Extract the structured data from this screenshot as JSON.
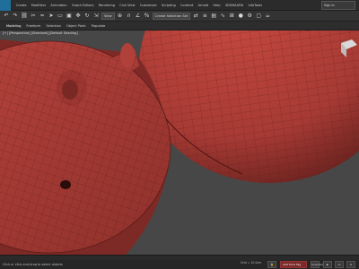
{
  "menubar": {
    "items": [
      "Create",
      "Modifiers",
      "Animation",
      "Graph Editors",
      "Rendering",
      "Civil View",
      "Customize",
      "Scripting",
      "Content",
      "Arnold",
      "Help",
      "3DSMAXFAI",
      "InfoTools"
    ],
    "workspace": "Sign In"
  },
  "toolbar": {
    "icons": [
      "undo",
      "redo",
      "link",
      "unlink",
      "bind",
      "select",
      "rect-select",
      "window",
      "move",
      "rotate",
      "scale"
    ],
    "view_select": "View",
    "selection_set": "Create Selection Set"
  },
  "ribbon": {
    "tabs": [
      "Modeling",
      "Freeform",
      "Selection",
      "Object Paint",
      "Populate"
    ]
  },
  "viewport": {
    "label": "[+] [Perspective] [Standard] [Default Shading]",
    "mesh_color": "#b5403a",
    "background": "#474747"
  },
  "status": {
    "prompt": "Click or click-and-drag to select objects",
    "coords": "Grid = 10.0cm",
    "auto_key": "Add Time Tag",
    "set_key": "Selected"
  },
  "colors": {
    "accent": "#1f6f9a",
    "mesh": "#b5403a",
    "mesh_dark": "#8a2e2a",
    "wire": "#5a1a18"
  }
}
